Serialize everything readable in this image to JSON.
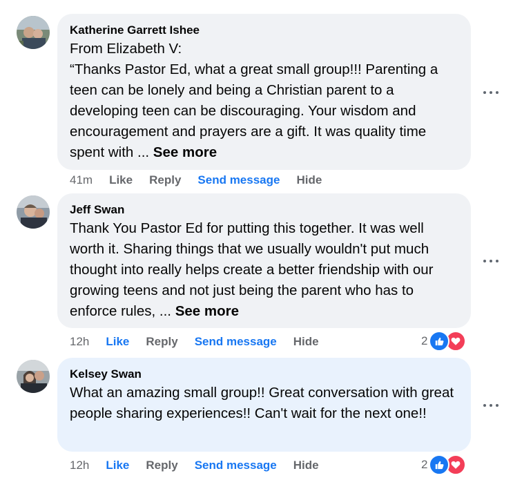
{
  "comments": [
    {
      "author": "Katherine Garrett Ishee",
      "lines": [
        "From Elizabeth V:",
        "“Thanks Pastor Ed, what a great small group!!! Parenting a teen can be lonely and being a Christian parent to a developing teen can be discouraging. Your wisdom and encouragement and prayers are a gift. It was quality time spent with ..."
      ],
      "see_more": "See more",
      "time": "41m",
      "like": "Like",
      "reply": "Reply",
      "send_message": "Send message",
      "hide": "Hide"
    },
    {
      "author": "Jeff Swan",
      "text": "Thank You Pastor Ed for putting this together. It was well worth it. Sharing things that we usually wouldn't put much thought into really helps create a better friendship with our growing teens and not just being the parent who has to enforce rules, ...",
      "see_more": "See more",
      "time": "12h",
      "like": "Like",
      "reply": "Reply",
      "send_message": "Send message",
      "hide": "Hide",
      "reaction_count": "2",
      "reactions": [
        "like-icon",
        "love-icon"
      ]
    },
    {
      "author": "Kelsey Swan",
      "text": "What an amazing small group!! Great conversation with great people sharing experiences!! Can't wait for the next one!!",
      "time": "12h",
      "like": "Like",
      "reply": "Reply",
      "send_message": "Send message",
      "hide": "Hide",
      "reaction_count": "2",
      "reactions": [
        "like-icon",
        "love-icon"
      ]
    }
  ],
  "colors": {
    "bubble": "#f0f2f5",
    "bubble_highlight": "#e9f2fd",
    "link_blue": "#1877f2",
    "secondary_text": "#65676b",
    "love_red": "#f33e58"
  }
}
